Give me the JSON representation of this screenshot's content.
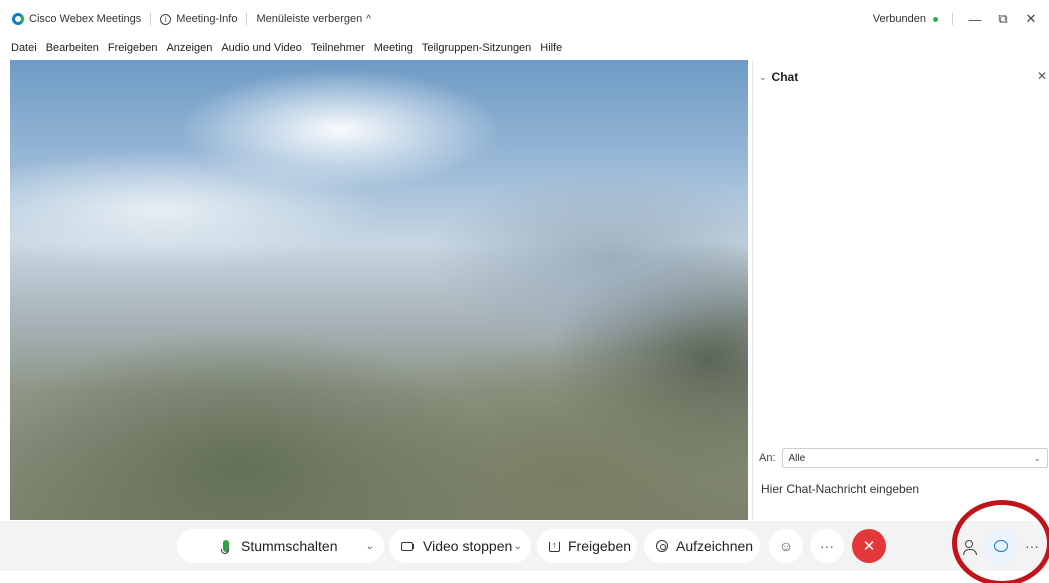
{
  "titlebar": {
    "app_name": "Cisco Webex Meetings",
    "meeting_info": "Meeting-Info",
    "meeting_info_icon": "i",
    "hide_menubar": "Menüleiste verbergen",
    "hide_caret": "^",
    "connection_status": "Verbunden",
    "status_color": "#2fb34a",
    "minimize": "—",
    "restore": "⧉",
    "close": "✕"
  },
  "menubar": {
    "items": [
      "Datei",
      "Bearbeiten",
      "Freigeben",
      "Anzeigen",
      "Audio und Video",
      "Teilnehmer",
      "Meeting",
      "Teilgruppen-Sitzungen",
      "Hilfe"
    ]
  },
  "chat": {
    "title": "Chat",
    "collapse_glyph": "⌄",
    "close_glyph": "✕",
    "to_label": "An:",
    "to_value": "Alle",
    "to_caret": "⌄",
    "input_placeholder": "Hier Chat-Nachricht eingeben"
  },
  "controls": {
    "mute_label": "Stummschalten",
    "mute_caret": "⌄",
    "video_label": "Video stoppen",
    "video_caret": "⌄",
    "share_label": "Freigeben",
    "share_glyph": "↑",
    "record_label": "Aufzeichnen",
    "reactions_glyph": "☺",
    "more_glyph": "···",
    "end_glyph": "✕",
    "end_color": "#e4373a",
    "right_more_glyph": "···",
    "chat_active_color": "#1677d2"
  },
  "annotation": {
    "ring_color": "#c0141b"
  }
}
